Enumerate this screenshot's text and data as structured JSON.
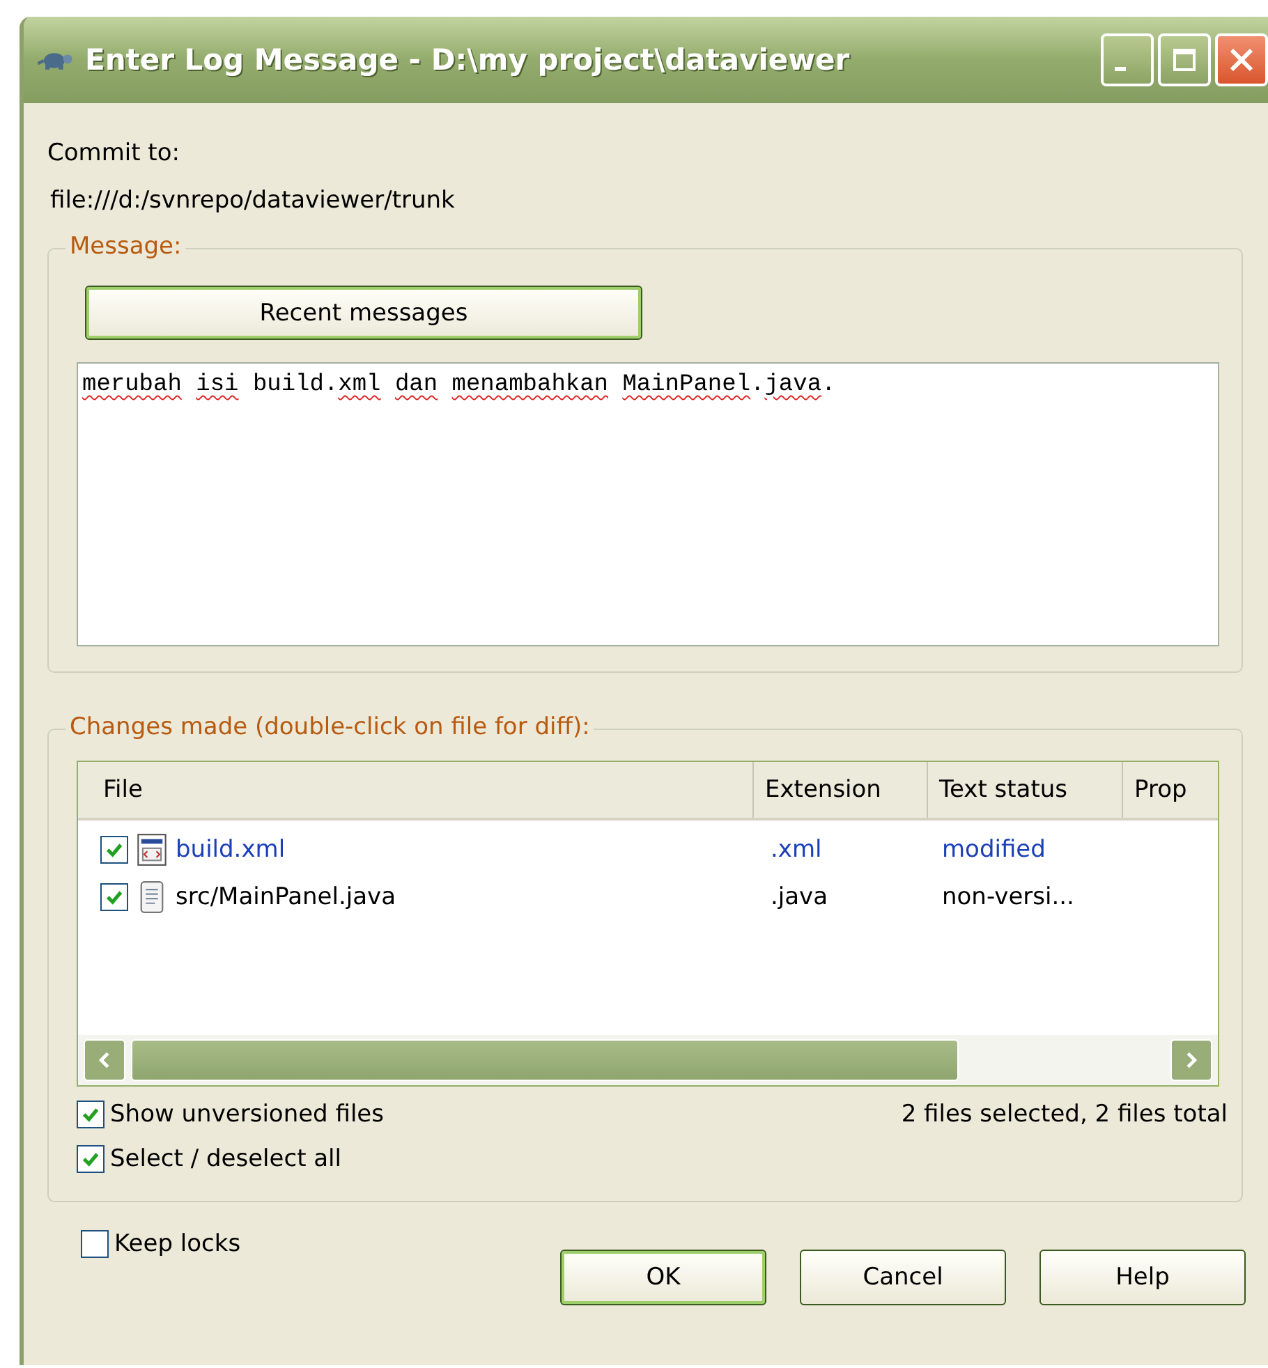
{
  "window": {
    "title": "Enter Log Message - D:\\my project\\dataviewer"
  },
  "commit_to": {
    "label": "Commit to:",
    "url": "file:///d:/svnrepo/dataviewer/trunk"
  },
  "message_group": {
    "title": "Message:",
    "recent_button": "Recent messages",
    "words": [
      {
        "parts": [
          {
            "text": "merubah",
            "misspelled": true
          }
        ]
      },
      {
        "parts": [
          {
            "text": "isi",
            "misspelled": true
          }
        ]
      },
      {
        "parts": [
          {
            "text": "build.",
            "misspelled": false
          },
          {
            "text": "xml",
            "misspelled": true
          }
        ]
      },
      {
        "parts": [
          {
            "text": "dan",
            "misspelled": true
          }
        ]
      },
      {
        "parts": [
          {
            "text": "menambahkan",
            "misspelled": true
          }
        ]
      },
      {
        "parts": [
          {
            "text": "MainPanel",
            "misspelled": true
          },
          {
            "text": ".",
            "misspelled": false
          },
          {
            "text": "java",
            "misspelled": true
          },
          {
            "text": ".",
            "misspelled": false
          }
        ]
      }
    ]
  },
  "changes_group": {
    "title": "Changes made (double-click on file for diff):",
    "columns": [
      "File",
      "Extension",
      "Text status",
      "Prop"
    ],
    "rows": [
      {
        "file": "build.xml",
        "kind": "xml",
        "extension": ".xml",
        "text_status": "modified",
        "checked": true,
        "color": "#1a3fb8"
      },
      {
        "file": "src/MainPanel.java",
        "kind": "text",
        "extension": ".java",
        "text_status": "non-versi...",
        "checked": true,
        "color": "#000000"
      }
    ],
    "options": [
      {
        "label": "Show unversioned files",
        "checked": true
      },
      {
        "label": "Select / deselect all",
        "checked": true
      }
    ],
    "summary": "2 files selected, 2 files total"
  },
  "keep_locks": {
    "label": "Keep locks",
    "checked": false
  },
  "buttons": [
    "OK",
    "Cancel",
    "Help"
  ]
}
